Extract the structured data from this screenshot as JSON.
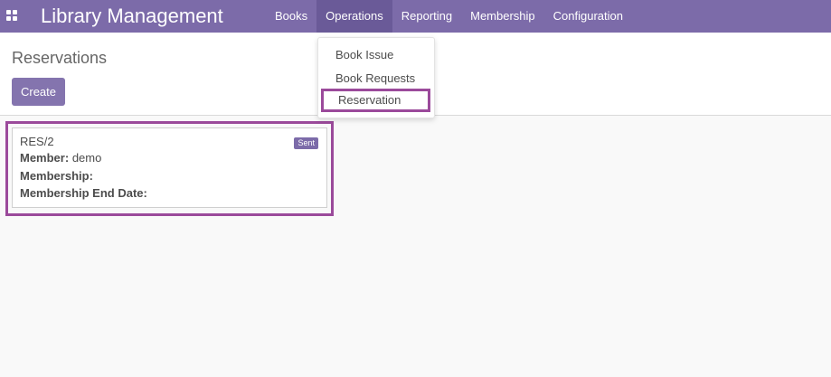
{
  "navbar": {
    "brand": "Library Management",
    "menu": [
      {
        "label": "Books"
      },
      {
        "label": "Operations"
      },
      {
        "label": "Reporting"
      },
      {
        "label": "Membership"
      },
      {
        "label": "Configuration"
      }
    ]
  },
  "page": {
    "title": "Reservations",
    "create_label": "Create"
  },
  "dropdown": {
    "items": [
      {
        "label": "Book Issue"
      },
      {
        "label": "Book Requests"
      },
      {
        "label": "Reservation"
      }
    ]
  },
  "card": {
    "ref": "RES/2",
    "badge": "Sent",
    "member_label": "Member:",
    "member_value": "demo",
    "membership_label": "Membership:",
    "membership_value": "",
    "end_date_label": "Membership End Date:",
    "end_date_value": ""
  },
  "colors": {
    "navbar": "#7c6ba9",
    "highlight": "#9b4a9b"
  }
}
